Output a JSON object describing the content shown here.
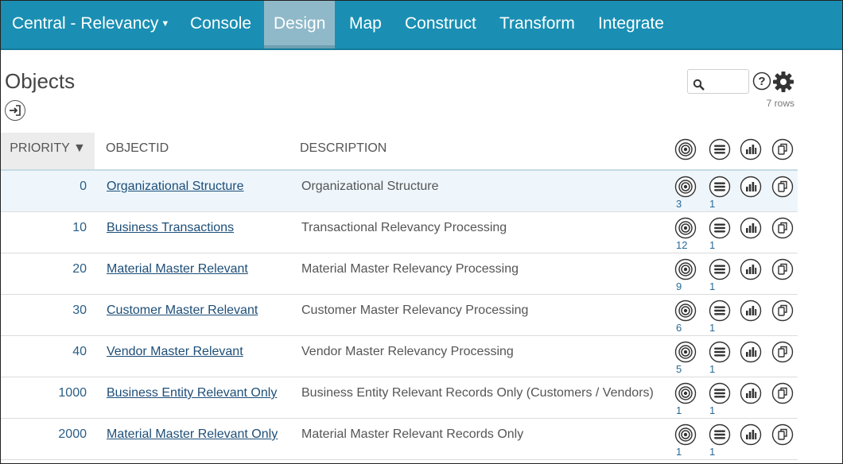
{
  "nav": {
    "items": [
      {
        "label": "Central - Relevancy",
        "dropdown": true
      },
      {
        "label": "Console"
      },
      {
        "label": "Design",
        "active": true
      },
      {
        "label": "Map"
      },
      {
        "label": "Construct"
      },
      {
        "label": "Transform"
      },
      {
        "label": "Integrate"
      }
    ],
    "bar_color": "#1a8fb3",
    "active_color": "#8fb9c9"
  },
  "page": {
    "title": "Objects",
    "row_count": "7 rows",
    "search_value": ""
  },
  "table": {
    "columns": {
      "priority": "PRIORITY ▼",
      "objectid": "OBJECTID",
      "description": "DESCRIPTION"
    },
    "header_icons": [
      "target-icon",
      "list-icon",
      "chart-icon",
      "copy-icon"
    ],
    "rows": [
      {
        "priority": "0",
        "objectid": "Organizational Structure",
        "description": "Organizational Structure",
        "count1": "3",
        "count2": "1"
      },
      {
        "priority": "10",
        "objectid": "Business Transactions",
        "description": "Transactional Relevancy Processing",
        "count1": "12",
        "count2": "1"
      },
      {
        "priority": "20",
        "objectid": "Material Master Relevant",
        "description": "Material Master Relevancy Processing",
        "count1": "9",
        "count2": "1"
      },
      {
        "priority": "30",
        "objectid": "Customer Master Relevant",
        "description": "Customer Master Relevancy Processing",
        "count1": "6",
        "count2": "1"
      },
      {
        "priority": "40",
        "objectid": "Vendor Master Relevant",
        "description": "Vendor Master Relevancy Processing",
        "count1": "5",
        "count2": "1"
      },
      {
        "priority": "1000",
        "objectid": "Business Entity Relevant Only",
        "description": "Business Entity Relevant Records Only (Customers / Vendors)",
        "count1": "1",
        "count2": "1"
      },
      {
        "priority": "2000",
        "objectid": "Material Master Relevant Only",
        "description": "Material Master Relevant Records Only",
        "count1": "1",
        "count2": "1"
      }
    ]
  }
}
